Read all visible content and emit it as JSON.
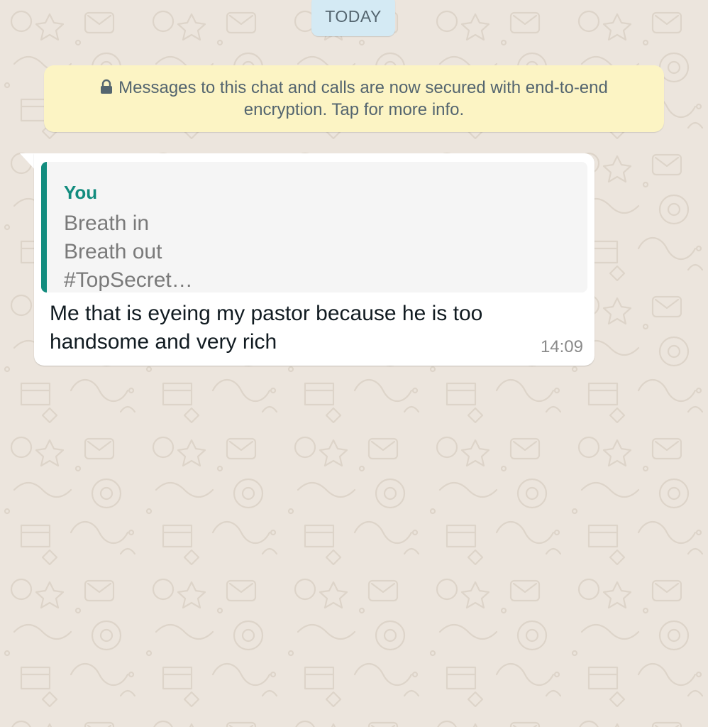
{
  "chat": {
    "date_chip": "TODAY",
    "encryption_notice": {
      "icon": "lock-icon",
      "text": "Messages to this chat and calls are now secured with end-to-end encryption. Tap for more info."
    },
    "messages": [
      {
        "direction": "incoming",
        "quoted": {
          "author": "You",
          "lines": [
            "Breath in",
            "Breath out",
            "#TopSecret…"
          ]
        },
        "text": "Me that is eyeing my pastor because he is too handsome and very rich",
        "time": "14:09"
      }
    ]
  },
  "colors": {
    "wallpaper": "#ece5dd",
    "date_chip_bg": "#d4eaf4",
    "notice_bg": "#fcf4c4",
    "quote_accent": "#128c7e",
    "bubble_bg": "#ffffff"
  }
}
